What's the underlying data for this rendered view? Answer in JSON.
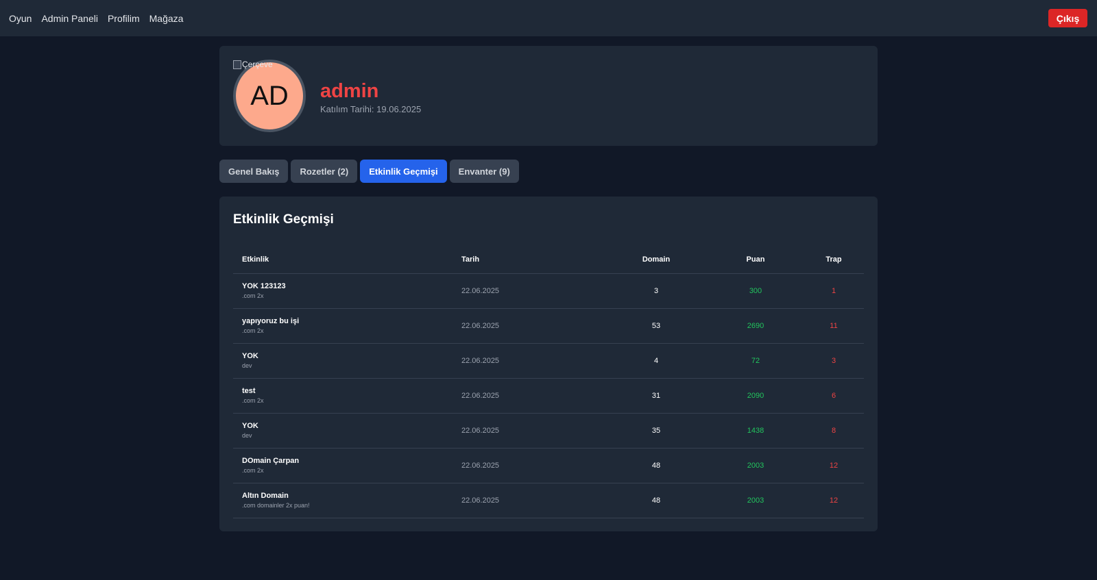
{
  "nav": {
    "links": [
      "Oyun",
      "Admin Paneli",
      "Profilim",
      "Mağaza"
    ],
    "logout": "Çıkış"
  },
  "profile": {
    "avatar_initials": "AD",
    "frame_alt": "Çerçeve",
    "username": "admin",
    "join_label": "Katılım Tarihi:",
    "join_date": "19.06.2025",
    "colors": {
      "username": "#ef4444",
      "avatar_bg": "#fda98c"
    }
  },
  "tabs": [
    {
      "label": "Genel Bakış",
      "active": false
    },
    {
      "label": "Rozetler (2)",
      "active": false
    },
    {
      "label": "Etkinlik Geçmişi",
      "active": true
    },
    {
      "label": "Envanter (9)",
      "active": false
    }
  ],
  "history": {
    "title": "Etkinlik Geçmişi",
    "columns": [
      "Etkinlik",
      "Tarih",
      "Domain",
      "Puan",
      "Trap"
    ],
    "rows": [
      {
        "name": "YOK 123123",
        "desc": ".com 2x",
        "date": "22.06.2025",
        "domain": "3",
        "score": "300",
        "trap": "1"
      },
      {
        "name": "yapıyoruz bu işi",
        "desc": ".com 2x",
        "date": "22.06.2025",
        "domain": "53",
        "score": "2690",
        "trap": "11"
      },
      {
        "name": "YOK",
        "desc": "dev",
        "date": "22.06.2025",
        "domain": "4",
        "score": "72",
        "trap": "3"
      },
      {
        "name": "test",
        "desc": ".com 2x",
        "date": "22.06.2025",
        "domain": "31",
        "score": "2090",
        "trap": "6"
      },
      {
        "name": "YOK",
        "desc": "dev",
        "date": "22.06.2025",
        "domain": "35",
        "score": "1438",
        "trap": "8"
      },
      {
        "name": "DOmain Çarpan",
        "desc": ".com 2x",
        "date": "22.06.2025",
        "domain": "48",
        "score": "2003",
        "trap": "12"
      },
      {
        "name": "Altın Domain",
        "desc": ".com domainler 2x puan!",
        "date": "22.06.2025",
        "domain": "48",
        "score": "2003",
        "trap": "12"
      }
    ]
  }
}
